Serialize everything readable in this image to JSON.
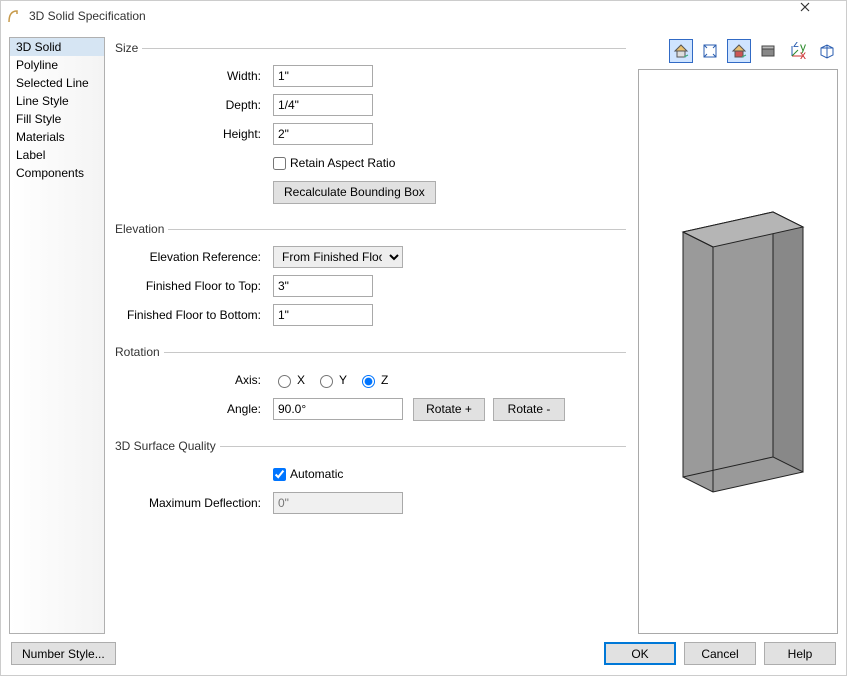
{
  "window": {
    "title": "3D Solid Specification"
  },
  "sidebar": {
    "items": [
      {
        "label": "3D Solid",
        "selected": true
      },
      {
        "label": "Polyline"
      },
      {
        "label": "Selected Line"
      },
      {
        "label": "Line Style"
      },
      {
        "label": "Fill Style"
      },
      {
        "label": "Materials"
      },
      {
        "label": "Label"
      },
      {
        "label": "Components"
      }
    ]
  },
  "size": {
    "legend": "Size",
    "width_label": "Width:",
    "width": "1\"",
    "depth_label": "Depth:",
    "depth": "1/4\"",
    "height_label": "Height:",
    "height": "2\"",
    "retain_label": "Retain Aspect Ratio",
    "retain": false,
    "recalc_label": "Recalculate Bounding Box"
  },
  "elevation": {
    "legend": "Elevation",
    "ref_label": "Elevation Reference:",
    "ref_value": "From Finished Floor",
    "top_label": "Finished Floor to Top:",
    "top": "3\"",
    "bottom_label": "Finished Floor to Bottom:",
    "bottom": "1\""
  },
  "rotation": {
    "legend": "Rotation",
    "axis_label": "Axis:",
    "axis_x": "X",
    "axis_y": "Y",
    "axis_z": "Z",
    "axis_selected": "Z",
    "angle_label": "Angle:",
    "angle": "90.0°",
    "rotate_plus": "Rotate +",
    "rotate_minus": "Rotate -"
  },
  "quality": {
    "legend": "3D Surface Quality",
    "auto_label": "Automatic",
    "auto": true,
    "deflect_label": "Maximum Deflection:",
    "deflect": "0\""
  },
  "footer": {
    "number_style": "Number Style...",
    "ok": "OK",
    "cancel": "Cancel",
    "help": "Help"
  },
  "toolbar": {
    "icons": [
      "house-elevation-icon",
      "fit-icon",
      "house-color-icon",
      "surface-icon",
      "axes-icon",
      "wireframe-cube-icon"
    ]
  }
}
